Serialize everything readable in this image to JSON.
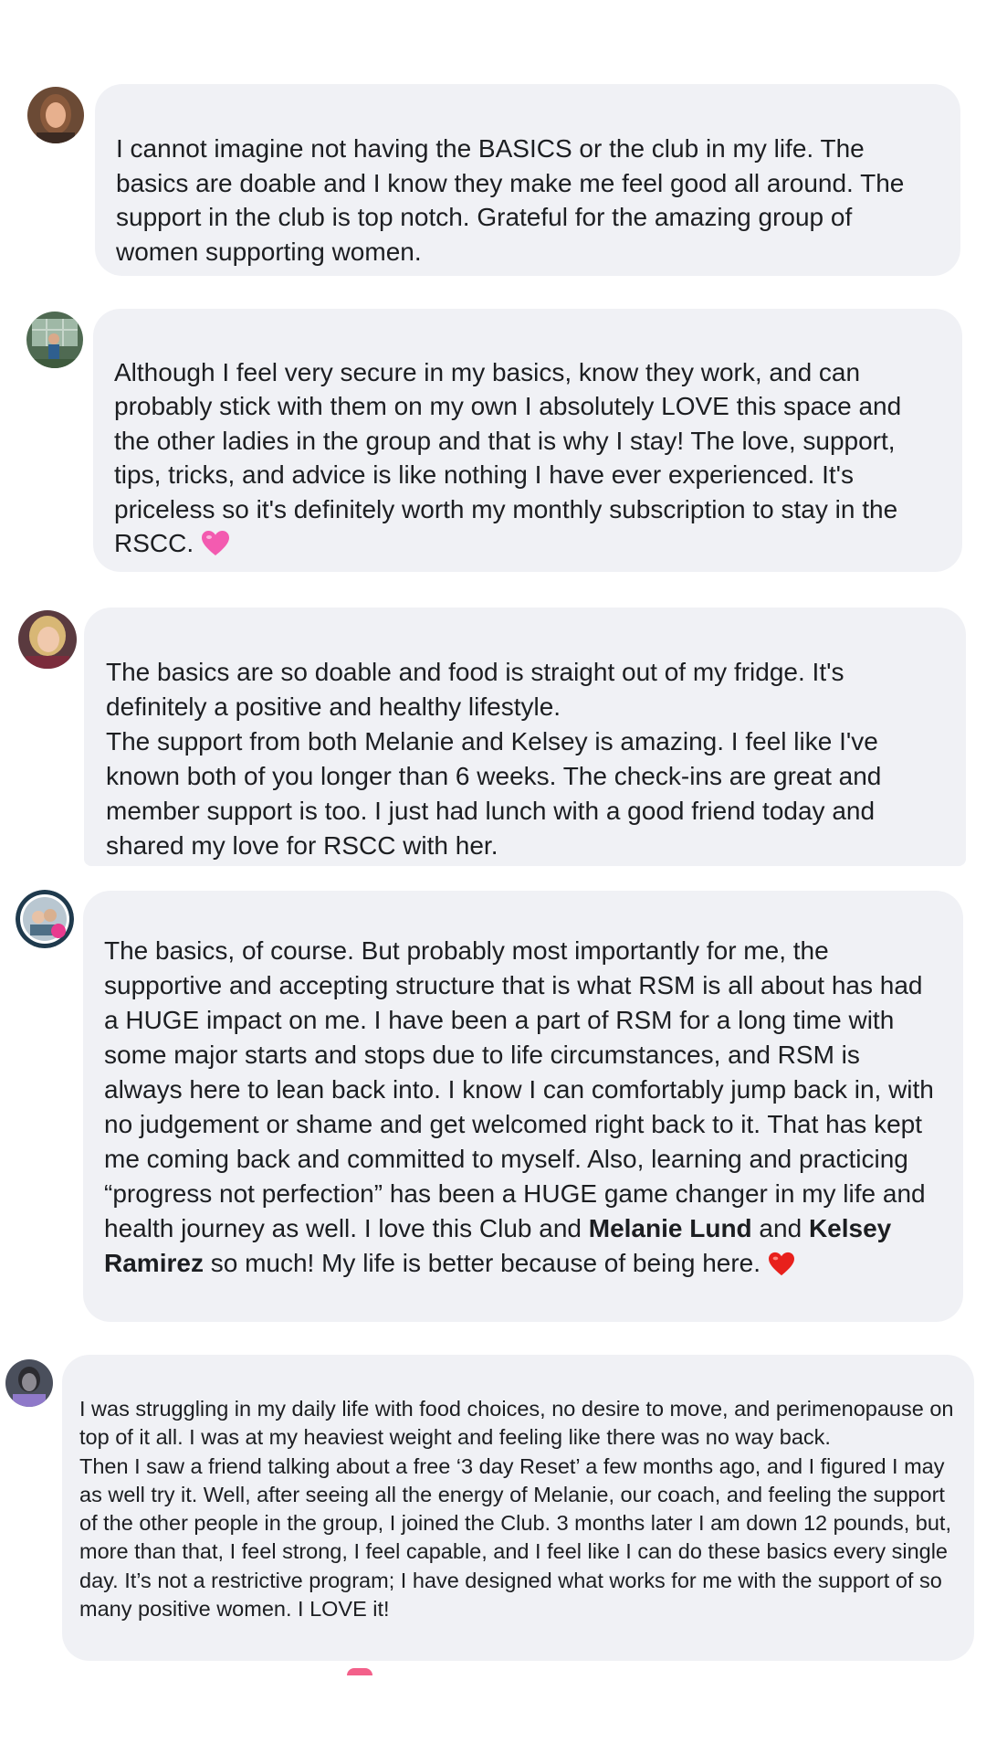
{
  "comments": [
    {
      "author_avatar": "profile-photo-woman-curly-hair",
      "text": "I cannot imagine not having the BASICS or the club in my life. The basics are doable and I know they make me feel good all around. The support in the club is top notch. Grateful for the amazing group of women supporting women."
    },
    {
      "author_avatar": "profile-photo-person-greenhouse",
      "text": "Although I feel very secure in my basics, know they work, and can probably stick with them on my own I absolutely LOVE this space and the other ladies in the group and that is why I stay! The love, support, tips, tricks, and advice is like nothing I have ever experienced. It's priceless so it's definitely worth my monthly subscription to stay in the RSCC.",
      "emoji": "pink-heart"
    },
    {
      "author_avatar": "profile-photo-blonde-woman",
      "text": "The basics are so doable and food is straight out of my fridge. It's definitely a positive and healthy lifestyle.\nThe support from both Melanie and Kelsey is amazing. I feel like I've known both of you longer than 6 weeks. The check-ins are great and member support is too. I just had lunch with a good friend today and shared my love for RSCC with her."
    },
    {
      "author_avatar": "profile-photo-couple-frame",
      "text_before": "The basics, of course. But probably most importantly for me, the supportive and accepting structure that is what RSM is all about has had a HUGE impact on me. I have been a part of RSM for a long time with some major starts and stops due to life circumstances, and RSM is always here to lean back into. I know I can comfortably jump back in, with no judgement or shame and get welcomed right back to it. That has kept me coming back and committed to myself. Also, learning and practicing “progress not perfection” has been a HUGE game changer in my life and health journey as well. I love this Club and ",
      "mention_1": "Melanie Lund",
      "text_middle": " and ",
      "mention_2": "Kelsey Ramirez",
      "text_after": " so much! My life is better because of being here.",
      "emoji": "red-heart"
    },
    {
      "author_avatar": "profile-photo-dark-hair",
      "text": "I was struggling in my daily life with food choices, no desire to move, and perimenopause on top of it all. I was at my heaviest weight and feeling like there was no way back.\nThen I saw a friend talking about a free ‘3 day Reset’ a few months ago, and I figured I may as well try it. Well, after seeing all the energy of Melanie, our coach, and feeling the support of the other people in the group, I joined the Club. 3 months later I am down 12 pounds, but, more than that, I feel strong, I feel capable, and I feel like I can do these basics every single day. It’s not a restrictive program; I have designed what works for me with the support of so many positive women. I LOVE it!"
    }
  ],
  "colors": {
    "bubble": "#f0f1f5",
    "text": "#1c1e21",
    "pink_heart": "#f35bb0",
    "red_heart": "#e8201c"
  }
}
